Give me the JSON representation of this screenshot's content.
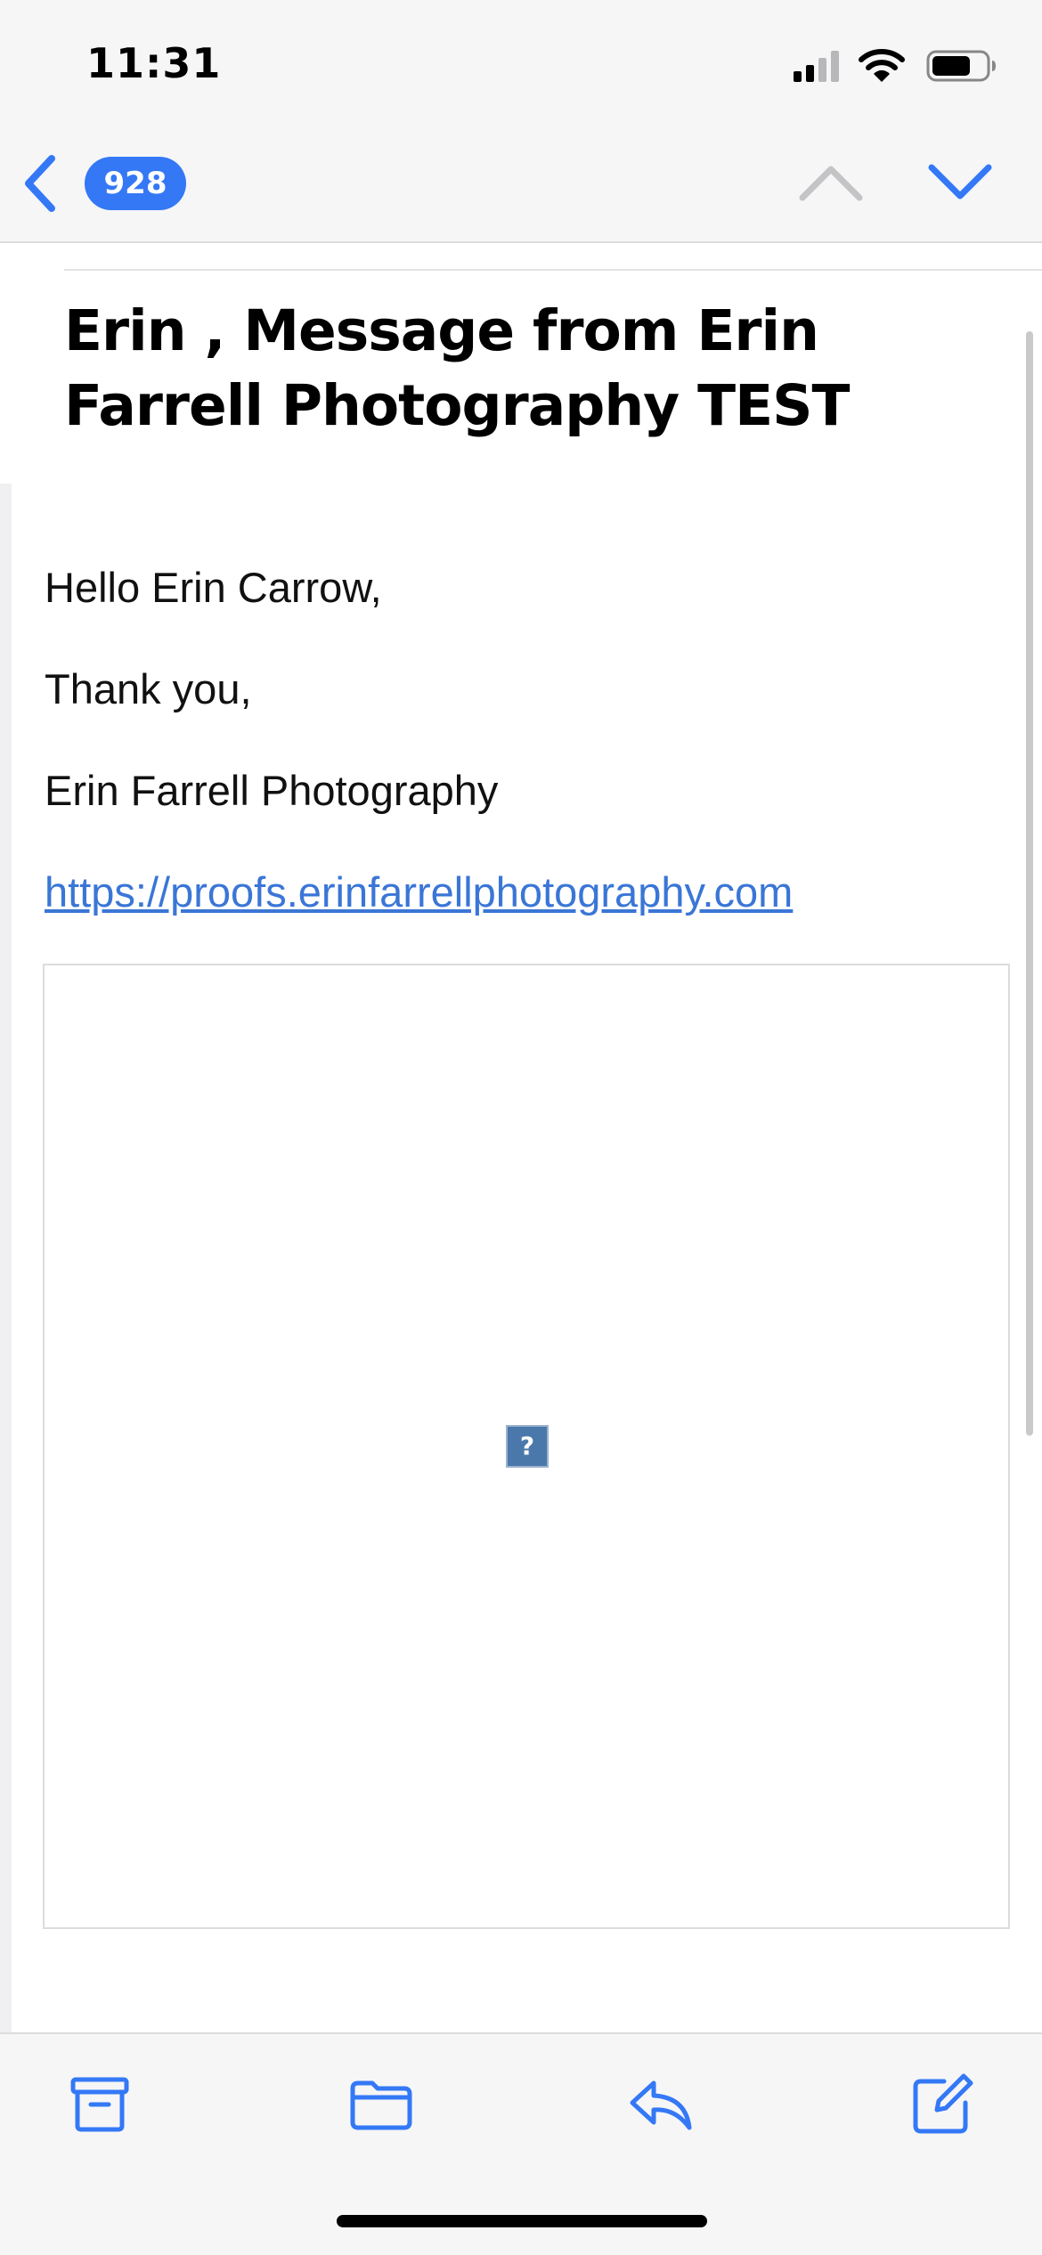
{
  "status_bar": {
    "time": "11:31",
    "signal_icon": "cellular-signal-icon",
    "wifi_icon": "wifi-icon",
    "battery_icon": "battery-icon",
    "signal_bars_filled": 2,
    "signal_bars_total": 4
  },
  "nav": {
    "back_icon": "chevron-left-icon",
    "unread_count": "928",
    "prev_icon": "chevron-up-icon",
    "next_icon": "chevron-down-icon"
  },
  "message": {
    "subject": "Erin , Message from Erin Farrell Photography TEST",
    "greeting": "Hello Erin Carrow,",
    "thanks": "Thank you,",
    "signature": "Erin Farrell Photography",
    "link": "https://proofs.erinfarrellphotography.com",
    "broken_image_glyph": "?"
  },
  "toolbar": {
    "archive_icon": "archive-icon",
    "move_icon": "folder-icon",
    "reply_icon": "reply-icon",
    "compose_icon": "compose-icon"
  },
  "colors": {
    "accent": "#3478f6",
    "link": "#3a76d6",
    "disabled": "#c4c4c6",
    "bar_background": "#f6f6f7"
  }
}
